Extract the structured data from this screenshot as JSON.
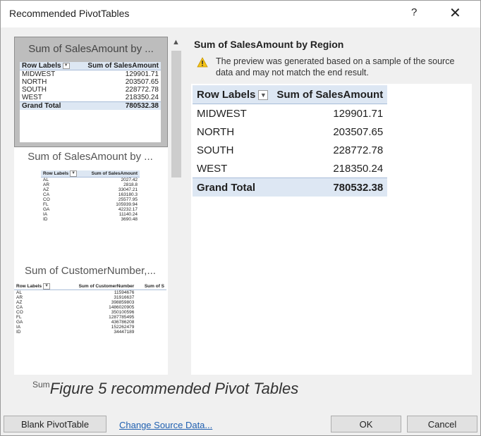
{
  "dialog": {
    "title": "Recommended PivotTables",
    "help_label": "?",
    "close_label": "✕"
  },
  "thumbnails": [
    {
      "title": "Sum of SalesAmount by ...",
      "headers": [
        "Row Labels",
        "Sum of SalesAmount"
      ],
      "rows": [
        [
          "MIDWEST",
          "129901.71"
        ],
        [
          "NORTH",
          "203507.65"
        ],
        [
          "SOUTH",
          "228772.78"
        ],
        [
          "WEST",
          "218350.24"
        ]
      ],
      "total": [
        "Grand Total",
        "780532.38"
      ]
    },
    {
      "title": "Sum of SalesAmount by ...",
      "headers": [
        "Row Labels",
        "Sum of SalesAmount"
      ],
      "rows": [
        [
          "AL",
          "2027.42"
        ],
        [
          "AR",
          "2818.8"
        ],
        [
          "AZ",
          "33047.21"
        ],
        [
          "CA",
          "163180.3"
        ],
        [
          "CO",
          "25577.95"
        ],
        [
          "FL",
          "105939.94"
        ],
        [
          "GA",
          "42232.17"
        ],
        [
          "IA",
          "11140.24"
        ],
        [
          "ID",
          "3690.48"
        ]
      ]
    },
    {
      "title": "Sum of CustomerNumber,...",
      "headers": [
        "Row Labels",
        "Sum of CustomerNumber",
        "Sum of S"
      ],
      "rows": [
        [
          "AL",
          "11594676"
        ],
        [
          "AR",
          "31916637"
        ],
        [
          "AZ",
          "398859803"
        ],
        [
          "CA",
          "1486020905"
        ],
        [
          "CO",
          "350100596"
        ],
        [
          "FL",
          "1287785495"
        ],
        [
          "GA",
          "436786208"
        ],
        [
          "IA",
          "152262479"
        ],
        [
          "ID",
          "34447189"
        ]
      ]
    }
  ],
  "preview": {
    "title": "Sum of SalesAmount by Region",
    "note": "The preview was generated based on a sample of the source data and may not match the end result.",
    "headers": [
      "Row Labels",
      "Sum of SalesAmount"
    ],
    "rows": [
      [
        "MIDWEST",
        "129901.71"
      ],
      [
        "NORTH",
        "203507.65"
      ],
      [
        "SOUTH",
        "228772.78"
      ],
      [
        "WEST",
        "218350.24"
      ]
    ],
    "total": [
      "Grand Total",
      "780532.38"
    ]
  },
  "caption": {
    "prefix": "Sum",
    "text": "Figure 5 recommended Pivot Tables"
  },
  "footer": {
    "blank_pivot": "Blank PivotTable",
    "change_source": "Change Source Data...",
    "ok": "OK",
    "cancel": "Cancel"
  }
}
